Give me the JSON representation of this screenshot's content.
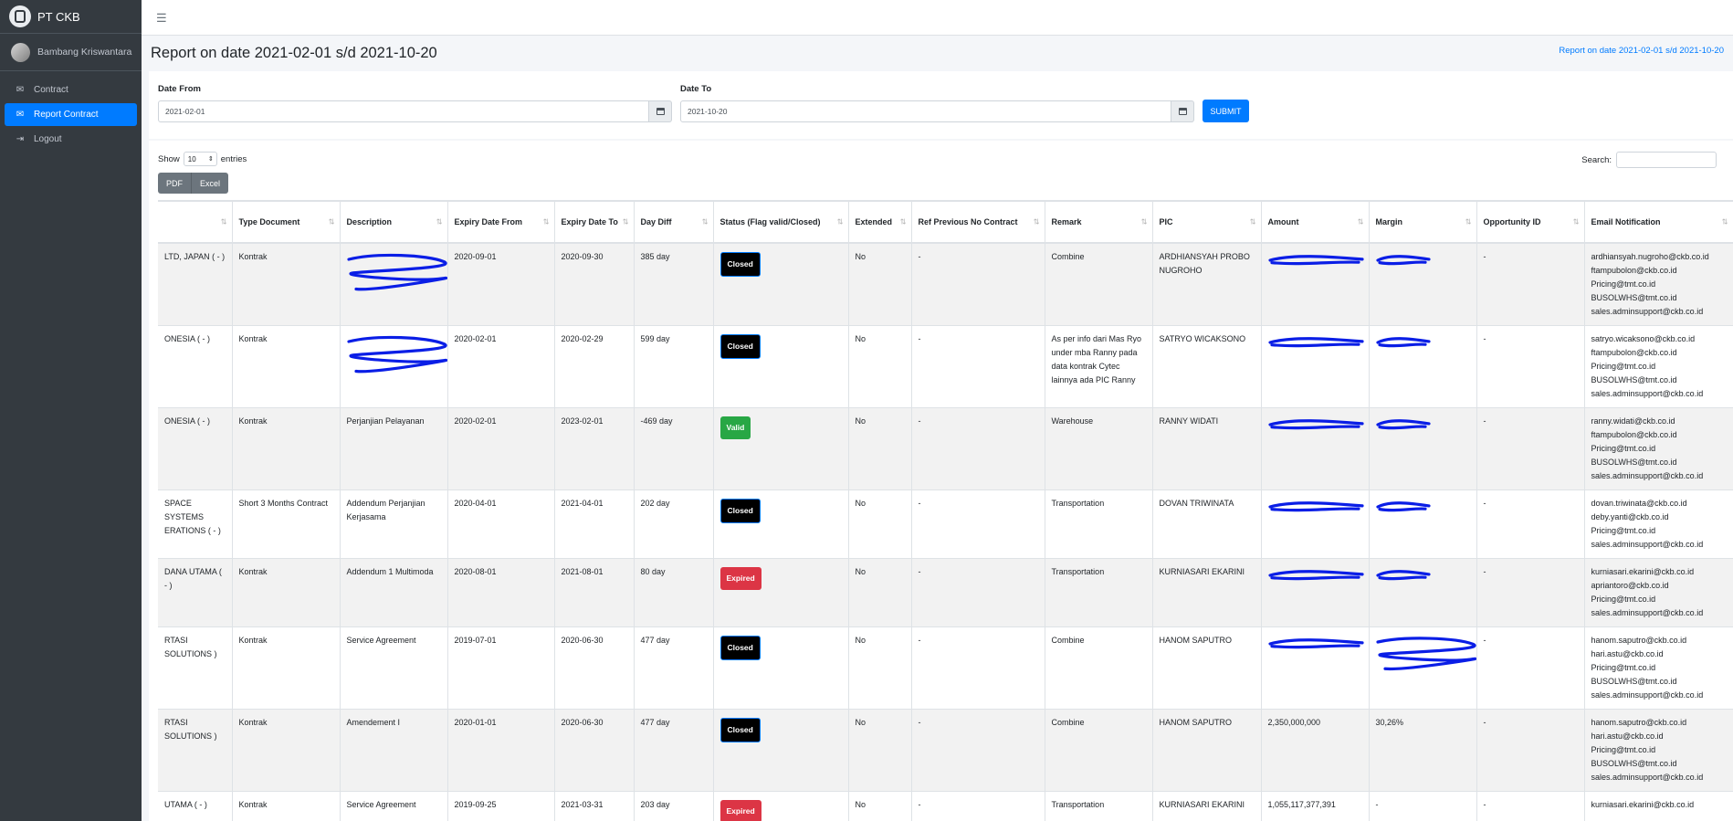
{
  "brand": {
    "name": "PT CKB"
  },
  "user": {
    "name": "Bambang Kriswantara"
  },
  "sidebar": {
    "items": [
      {
        "label": "Contract",
        "icon": "envelope-icon",
        "active": false
      },
      {
        "label": "Report Contract",
        "icon": "envelope-icon",
        "active": true
      },
      {
        "label": "Logout",
        "icon": "sign-out-icon",
        "active": false
      }
    ]
  },
  "page": {
    "title": "Report on date 2021-02-01 s/d 2021-10-20",
    "breadcrumb": "Report on date 2021-02-01 s/d 2021-10-20"
  },
  "filter": {
    "date_from_label": "Date From",
    "date_from_value": "2021-02-01",
    "date_to_label": "Date To",
    "date_to_value": "2021-10-20",
    "submit_label": "SUBMIT"
  },
  "table_controls": {
    "show_label": "Show",
    "entries_value": "10",
    "entries_label": "entries",
    "search_label": "Search:",
    "pdf_label": "PDF",
    "excel_label": "Excel"
  },
  "colors": {
    "sidebar_bg": "#343a40",
    "accent": "#007bff",
    "valid": "#28a745",
    "expired": "#dc3545",
    "closed": "#000000",
    "redaction": "#0a1ee6"
  },
  "table": {
    "headers": [
      "",
      "Type Document",
      "Description",
      "Expiry Date From",
      "Expiry Date To",
      "Day Diff",
      "Status (Flag valid/Closed)",
      "Extended",
      "Ref Previous No Contract",
      "Remark",
      "PIC",
      "Amount",
      "Margin",
      "Opportunity ID",
      "Email Notification"
    ],
    "rows": [
      {
        "company": "LTD, JAPAN ( - )",
        "type": "Kontrak",
        "description": "",
        "from": "2020-09-01",
        "to": "2020-09-30",
        "diff": "385 day",
        "status": "Closed",
        "extended": "No",
        "ref": "-",
        "remark": "Combine",
        "pic": "ARDHIANSYAH PROBO NUGROHO",
        "amount": "",
        "margin": "",
        "opp": "-",
        "emails": "ardhiansyah.nugroho@ckb.co.id\nftampubolon@ckb.co.id\nPricing@tmt.co.id\nBUSOLWHS@tmt.co.id\nsales.adminsupport@ckb.co.id"
      },
      {
        "company": "ONESIA ( - )",
        "type": "Kontrak",
        "description": "",
        "from": "2020-02-01",
        "to": "2020-02-29",
        "diff": "599 day",
        "status": "Closed",
        "extended": "No",
        "ref": "-",
        "remark": "As per info dari Mas Ryo under mba Ranny pada data kontrak Cytec lainnya ada PIC Ranny",
        "pic": "SATRYO WICAKSONO",
        "amount": "",
        "margin": "",
        "opp": "-",
        "emails": "satryo.wicaksono@ckb.co.id\nftampubolon@ckb.co.id\nPricing@tmt.co.id\nBUSOLWHS@tmt.co.id\nsales.adminsupport@ckb.co.id"
      },
      {
        "company": "ONESIA ( - )",
        "type": "Kontrak",
        "description": "Perjanjian Pelayanan",
        "from": "2020-02-01",
        "to": "2023-02-01",
        "diff": "-469 day",
        "status": "Valid",
        "extended": "No",
        "ref": "-",
        "remark": "Warehouse",
        "pic": "RANNY WIDATI",
        "amount": "",
        "margin": "",
        "opp": "-",
        "emails": "ranny.widati@ckb.co.id\nftampubolon@ckb.co.id\nPricing@tmt.co.id\nBUSOLWHS@tmt.co.id\nsales.adminsupport@ckb.co.id"
      },
      {
        "company": "SPACE SYSTEMS ERATIONS ( - )",
        "type": "Short 3 Months Contract",
        "description": "Addendum Perjanjian Kerjasama",
        "from": "2020-04-01",
        "to": "2021-04-01",
        "diff": "202 day",
        "status": "Closed",
        "extended": "No",
        "ref": "-",
        "remark": "Transportation",
        "pic": "DOVAN TRIWINATA",
        "amount": "",
        "margin": "",
        "opp": "-",
        "emails": "dovan.triwinata@ckb.co.id\ndeby.yanti@ckb.co.id\nPricing@tmt.co.id\nsales.adminsupport@ckb.co.id"
      },
      {
        "company": "DANA UTAMA ( - )",
        "type": "Kontrak",
        "description": "Addendum 1 Multimoda",
        "from": "2020-08-01",
        "to": "2021-08-01",
        "diff": "80 day",
        "status": "Expired",
        "extended": "No",
        "ref": "-",
        "remark": "Transportation",
        "pic": "KURNIASARI EKARINI",
        "amount": "",
        "margin": "",
        "opp": "-",
        "emails": "kurniasari.ekarini@ckb.co.id\napriantoro@ckb.co.id\nPricing@tmt.co.id\nsales.adminsupport@ckb.co.id"
      },
      {
        "company": "RTASI SOLUTIONS )",
        "type": "Kontrak",
        "description": "Service Agreement",
        "from": "2019-07-01",
        "to": "2020-06-30",
        "diff": "477 day",
        "status": "Closed",
        "extended": "No",
        "ref": "-",
        "remark": "Combine",
        "pic": "HANOM SAPUTRO",
        "amount": "",
        "margin": "",
        "opp": "-",
        "emails": "hanom.saputro@ckb.co.id\nhari.astu@ckb.co.id\nPricing@tmt.co.id\nBUSOLWHS@tmt.co.id\nsales.adminsupport@ckb.co.id"
      },
      {
        "company": "RTASI SOLUTIONS )",
        "type": "Kontrak",
        "description": "Amendement I",
        "from": "2020-01-01",
        "to": "2020-06-30",
        "diff": "477 day",
        "status": "Closed",
        "extended": "No",
        "ref": "-",
        "remark": "Combine",
        "pic": "HANOM SAPUTRO",
        "amount": "2,350,000,000",
        "margin": "30,26%",
        "opp": "-",
        "emails": "hanom.saputro@ckb.co.id\nhari.astu@ckb.co.id\nPricing@tmt.co.id\nBUSOLWHS@tmt.co.id\nsales.adminsupport@ckb.co.id"
      },
      {
        "company": "UTAMA ( - )",
        "type": "Kontrak",
        "description": "Service Agreement",
        "from": "2019-09-25",
        "to": "2021-03-31",
        "diff": "203 day",
        "status": "Expired",
        "extended": "No",
        "ref": "-",
        "remark": "Transportation",
        "pic": "KURNIASARI EKARINI",
        "amount": "1,055,117,377,391",
        "margin": "-",
        "opp": "-",
        "emails": "kurniasari.ekarini@ckb.co.id"
      }
    ]
  }
}
